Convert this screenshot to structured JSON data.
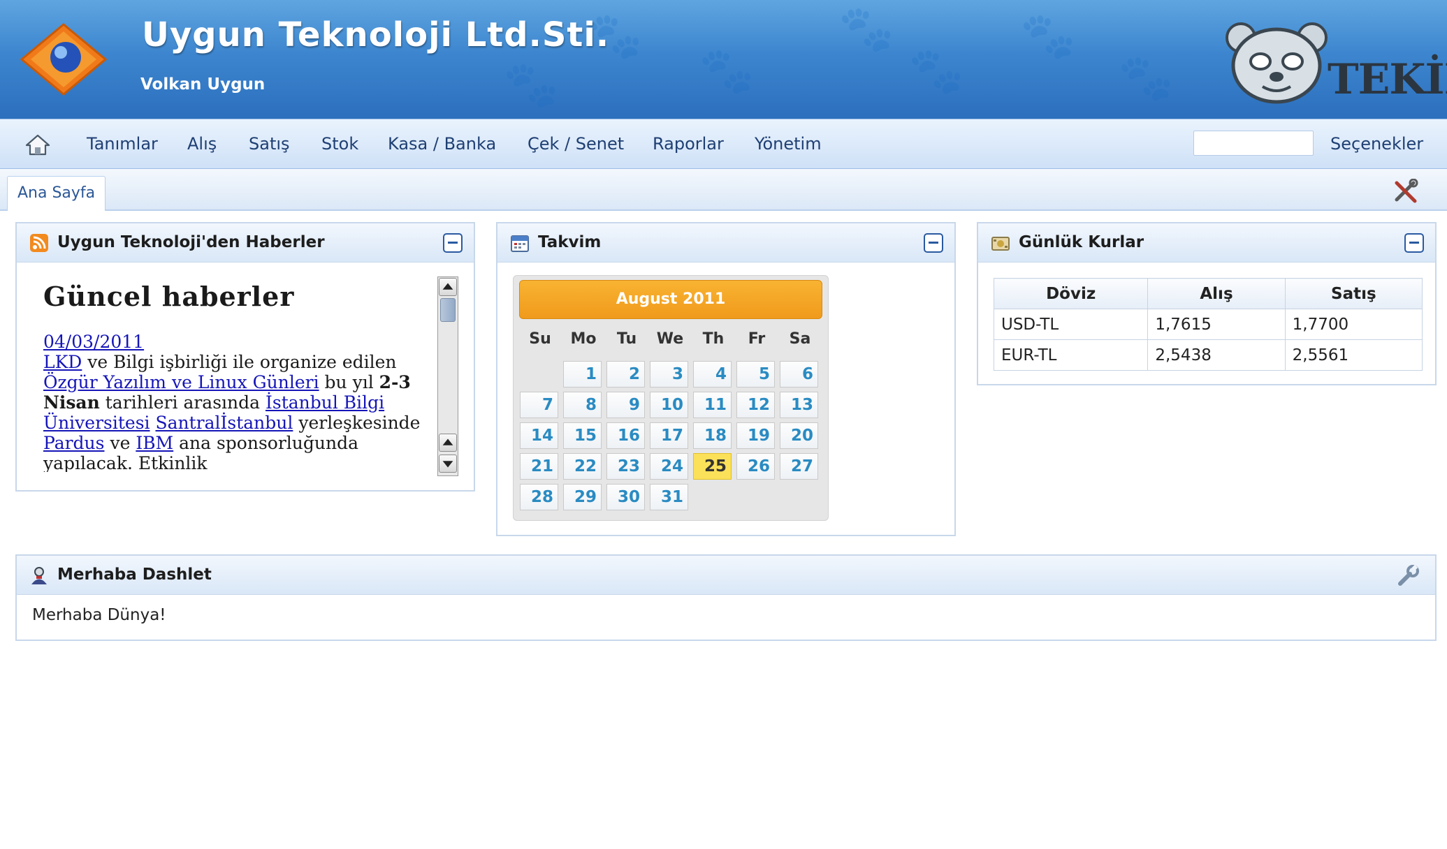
{
  "header": {
    "company_name": "Uygun Teknoloji Ltd.Sti.",
    "user_name": "Volkan Uygun",
    "brand_text": "TEKİR",
    "logo_icon": "orange-diamond-globe-logo",
    "mascot_icon": "cat-mascot-icon",
    "background_color": "#3d86cf"
  },
  "menu": {
    "home_icon": "home-icon",
    "items": [
      {
        "label": "Tanımlar"
      },
      {
        "label": "Alış"
      },
      {
        "label": "Satış"
      },
      {
        "label": "Stok"
      },
      {
        "label": "Kasa / Banka"
      },
      {
        "label": "Çek / Senet"
      },
      {
        "label": "Raporlar"
      },
      {
        "label": "Yönetim"
      }
    ],
    "search_value": "",
    "options_label": "Seçenekler"
  },
  "tabs": {
    "active_label": "Ana Sayfa",
    "tools_icon": "tools-icon"
  },
  "news": {
    "title": "Uygun Teknoloji'den Haberler",
    "icon": "rss-icon",
    "heading": "Güncel haberler",
    "date": "04/03/2011",
    "link_lkd": "LKD",
    "text_1": " ve Bilgi işbirliği ile organize edilen ",
    "link_event": "Özgür Yazılım ve Linux Günleri",
    "text_2": " bu yıl ",
    "bold_date": "2-3 Nisan",
    "text_3": " tarihleri arasında ",
    "link_university": "İstanbul Bilgi Üniversitesi",
    "text_4": " ",
    "link_campus": "Santralİstanbul",
    "text_5": " yerleşkesinde ",
    "link_pardus": "Pardus",
    "text_6": " ve ",
    "link_ibm": "IBM",
    "text_7": " ana sponsorluğunda yapılacak. Etkinlik"
  },
  "calendar": {
    "title": "Takvim",
    "icon": "calendar-icon",
    "month_label": "August 2011",
    "accent_color": "#f09a1b",
    "weekdays": [
      "Su",
      "Mo",
      "Tu",
      "We",
      "Th",
      "Fr",
      "Sa"
    ],
    "weeks": [
      [
        "",
        "1",
        "2",
        "3",
        "4",
        "5",
        "6"
      ],
      [
        "7",
        "8",
        "9",
        "10",
        "11",
        "12",
        "13"
      ],
      [
        "14",
        "15",
        "16",
        "17",
        "18",
        "19",
        "20"
      ],
      [
        "21",
        "22",
        "23",
        "24",
        "25",
        "26",
        "27"
      ],
      [
        "28",
        "29",
        "30",
        "31",
        "",
        "",
        ""
      ]
    ],
    "today": "25",
    "today_color": "#fbe15a"
  },
  "rates": {
    "title": "Günlük Kurlar",
    "icon": "currency-icon",
    "columns": [
      "Döviz",
      "Alış",
      "Satış"
    ],
    "rows": [
      [
        "USD-TL",
        "1,7615",
        "1,7700"
      ],
      [
        "EUR-TL",
        "2,5438",
        "2,5561"
      ]
    ]
  },
  "hello": {
    "title": "Merhaba Dashlet",
    "icon": "person-icon",
    "text": "Merhaba Dünya!",
    "settings_icon": "wrench-icon"
  }
}
